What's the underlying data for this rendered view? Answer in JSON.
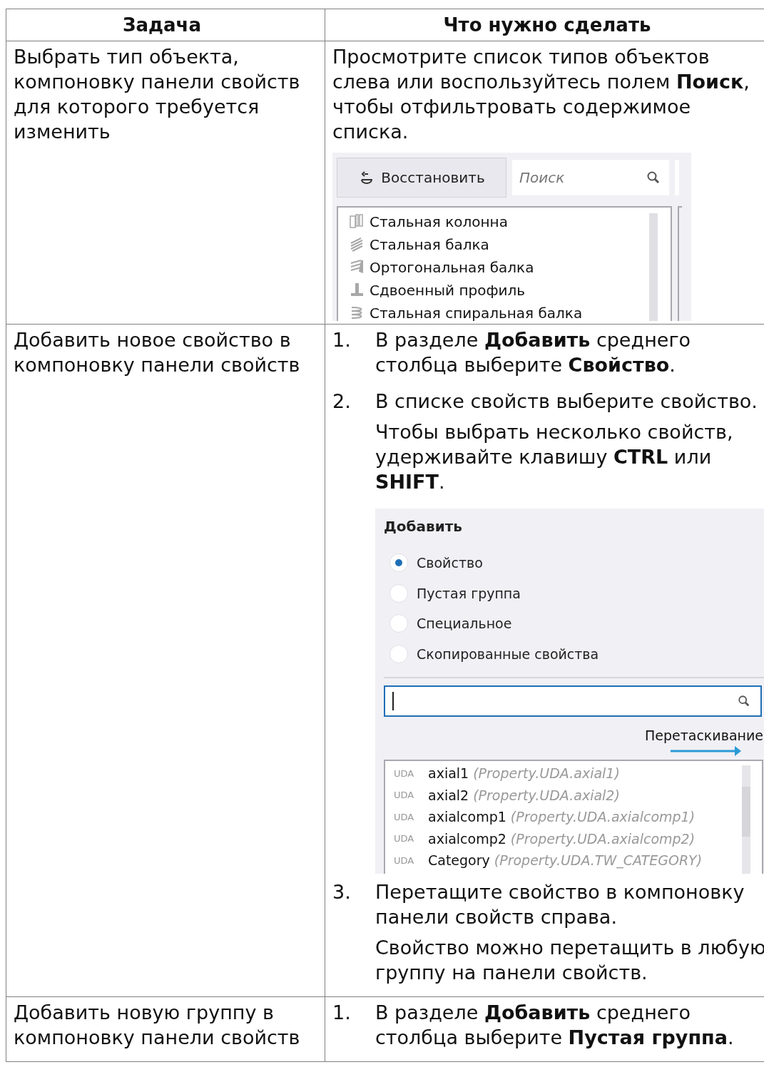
{
  "table": {
    "columns": [
      "Задача",
      "Что нужно сделать"
    ],
    "rows": [
      {
        "task": "Выбрать тип объекта, компоновку панели свойств для которого требуется изменить",
        "blocks": [
          {
            "kind": "text",
            "text": "Просмотрите список типов объектов слева или воспользуйтесь полем **Поиск**, чтобы отфильтровать содержимое списка."
          },
          {
            "kind": "object_panel",
            "restore_button": "Восстановить",
            "search": {
              "placeholder": "Поиск"
            },
            "items": [
              "Стальная колонна",
              "Стальная балка",
              "Ортогональная балка",
              "Сдвоенный профиль",
              "Стальная спиральная балка"
            ]
          }
        ]
      },
      {
        "task": "Добавить новое свойство в компоновку панели свойств",
        "blocks": [
          {
            "kind": "step",
            "number": "1.",
            "text": "В разделе **Добавить** среднего столбца выберите **Свойство**."
          },
          {
            "kind": "step",
            "number": "2.",
            "text": "В списке свойств выберите свойство.",
            "blocks": [
              {
                "kind": "text",
                "text": "Чтобы выбрать несколько свойств, удерживайте клавишу **CTRL** или **SHIFT**."
              },
              {
                "kind": "add_panel",
                "title": "Добавить",
                "options": [
                  {
                    "label": "Свойство",
                    "selected": true
                  },
                  {
                    "label": "Пустая группа",
                    "selected": false
                  },
                  {
                    "label": "Специальное",
                    "selected": false
                  },
                  {
                    "label": "Скопированные свойства",
                    "selected": false
                  }
                ],
                "drag_hint": "Перетаскивание",
                "properties": [
                  {
                    "tag": "UDA",
                    "name": "axial1",
                    "path": "(Property.UDA.axial1)"
                  },
                  {
                    "tag": "UDA",
                    "name": "axial2",
                    "path": "(Property.UDA.axial2)"
                  },
                  {
                    "tag": "UDA",
                    "name": "axialcomp1",
                    "path": "(Property.UDA.axialcomp1)"
                  },
                  {
                    "tag": "UDA",
                    "name": "axialcomp2",
                    "path": "(Property.UDA.axialcomp2)"
                  },
                  {
                    "tag": "UDA",
                    "name": "Category",
                    "path": "(Property.UDA.TW_CATEGORY)"
                  }
                ]
              }
            ]
          },
          {
            "kind": "step",
            "number": "3.",
            "text": "Перетащите свойство в компоновку панели свойств справа.",
            "blocks": [
              {
                "kind": "text",
                "text": "Свойство можно перетащить в любую группу на панели свойств."
              }
            ]
          }
        ]
      },
      {
        "task": "Добавить новую группу в компоновку панели свойств",
        "blocks": [
          {
            "kind": "step",
            "number": "1.",
            "text": "В разделе **Добавить** среднего столбца выберите **Пустая группа**."
          }
        ]
      }
    ]
  }
}
